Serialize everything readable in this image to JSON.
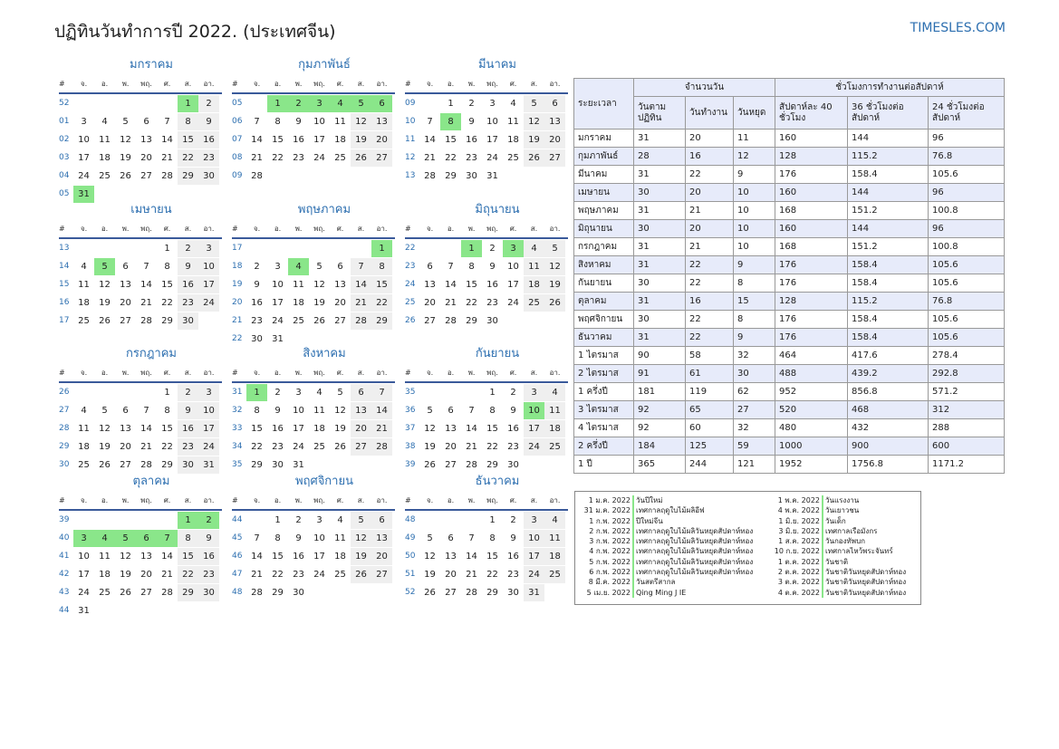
{
  "title": "ปฏิทินวันทำการปี 2022. (ประเทศจีน)",
  "site": "TIMESLES.COM",
  "day_headers": [
    "#",
    "จ.",
    "อ.",
    "พ.",
    "พฤ.",
    "ศ.",
    "ส.",
    "อา."
  ],
  "months": [
    {
      "name": "มกราคม",
      "weeks": [
        {
          "w": "52",
          "days": [
            "",
            "",
            "",
            "",
            "",
            "1",
            "2"
          ],
          "hol": [
            5
          ]
        },
        {
          "w": "01",
          "days": [
            "3",
            "4",
            "5",
            "6",
            "7",
            "8",
            "9"
          ],
          "hol": []
        },
        {
          "w": "02",
          "days": [
            "10",
            "11",
            "12",
            "13",
            "14",
            "15",
            "16"
          ],
          "hol": []
        },
        {
          "w": "03",
          "days": [
            "17",
            "18",
            "19",
            "20",
            "21",
            "22",
            "23"
          ],
          "hol": []
        },
        {
          "w": "04",
          "days": [
            "24",
            "25",
            "26",
            "27",
            "28",
            "29",
            "30"
          ],
          "hol": []
        },
        {
          "w": "05",
          "days": [
            "31",
            "",
            "",
            "",
            "",
            "",
            ""
          ],
          "hol": [
            0
          ]
        }
      ]
    },
    {
      "name": "กุมภาพันธ์",
      "weeks": [
        {
          "w": "05",
          "days": [
            "",
            "1",
            "2",
            "3",
            "4",
            "5",
            "6"
          ],
          "hol": [
            1,
            2,
            3,
            4,
            5,
            6
          ]
        },
        {
          "w": "06",
          "days": [
            "7",
            "8",
            "9",
            "10",
            "11",
            "12",
            "13"
          ],
          "hol": []
        },
        {
          "w": "07",
          "days": [
            "14",
            "15",
            "16",
            "17",
            "18",
            "19",
            "20"
          ],
          "hol": []
        },
        {
          "w": "08",
          "days": [
            "21",
            "22",
            "23",
            "24",
            "25",
            "26",
            "27"
          ],
          "hol": []
        },
        {
          "w": "09",
          "days": [
            "28",
            "",
            "",
            "",
            "",
            "",
            ""
          ],
          "hol": []
        }
      ]
    },
    {
      "name": "มีนาคม",
      "weeks": [
        {
          "w": "09",
          "days": [
            "",
            "1",
            "2",
            "3",
            "4",
            "5",
            "6"
          ],
          "hol": []
        },
        {
          "w": "10",
          "days": [
            "7",
            "8",
            "9",
            "10",
            "11",
            "12",
            "13"
          ],
          "hol": [
            1
          ]
        },
        {
          "w": "11",
          "days": [
            "14",
            "15",
            "16",
            "17",
            "18",
            "19",
            "20"
          ],
          "hol": []
        },
        {
          "w": "12",
          "days": [
            "21",
            "22",
            "23",
            "24",
            "25",
            "26",
            "27"
          ],
          "hol": []
        },
        {
          "w": "13",
          "days": [
            "28",
            "29",
            "30",
            "31",
            "",
            "",
            ""
          ],
          "hol": []
        }
      ]
    },
    {
      "name": "เมษายน",
      "weeks": [
        {
          "w": "13",
          "days": [
            "",
            "",
            "",
            "",
            "1",
            "2",
            "3"
          ],
          "hol": []
        },
        {
          "w": "14",
          "days": [
            "4",
            "5",
            "6",
            "7",
            "8",
            "9",
            "10"
          ],
          "hol": [
            1
          ]
        },
        {
          "w": "15",
          "days": [
            "11",
            "12",
            "13",
            "14",
            "15",
            "16",
            "17"
          ],
          "hol": []
        },
        {
          "w": "16",
          "days": [
            "18",
            "19",
            "20",
            "21",
            "22",
            "23",
            "24"
          ],
          "hol": []
        },
        {
          "w": "17",
          "days": [
            "25",
            "26",
            "27",
            "28",
            "29",
            "30",
            ""
          ],
          "hol": []
        }
      ]
    },
    {
      "name": "พฤษภาคม",
      "weeks": [
        {
          "w": "17",
          "days": [
            "",
            "",
            "",
            "",
            "",
            "",
            "1"
          ],
          "hol": [
            6
          ]
        },
        {
          "w": "18",
          "days": [
            "2",
            "3",
            "4",
            "5",
            "6",
            "7",
            "8"
          ],
          "hol": [
            2
          ]
        },
        {
          "w": "19",
          "days": [
            "9",
            "10",
            "11",
            "12",
            "13",
            "14",
            "15"
          ],
          "hol": []
        },
        {
          "w": "20",
          "days": [
            "16",
            "17",
            "18",
            "19",
            "20",
            "21",
            "22"
          ],
          "hol": []
        },
        {
          "w": "21",
          "days": [
            "23",
            "24",
            "25",
            "26",
            "27",
            "28",
            "29"
          ],
          "hol": []
        },
        {
          "w": "22",
          "days": [
            "30",
            "31",
            "",
            "",
            "",
            "",
            ""
          ],
          "hol": []
        }
      ]
    },
    {
      "name": "มิถุนายน",
      "weeks": [
        {
          "w": "22",
          "days": [
            "",
            "",
            "1",
            "2",
            "3",
            "4",
            "5"
          ],
          "hol": [
            2,
            4
          ]
        },
        {
          "w": "23",
          "days": [
            "6",
            "7",
            "8",
            "9",
            "10",
            "11",
            "12"
          ],
          "hol": []
        },
        {
          "w": "24",
          "days": [
            "13",
            "14",
            "15",
            "16",
            "17",
            "18",
            "19"
          ],
          "hol": []
        },
        {
          "w": "25",
          "days": [
            "20",
            "21",
            "22",
            "23",
            "24",
            "25",
            "26"
          ],
          "hol": []
        },
        {
          "w": "26",
          "days": [
            "27",
            "28",
            "29",
            "30",
            "",
            "",
            ""
          ],
          "hol": []
        }
      ]
    },
    {
      "name": "กรกฎาคม",
      "weeks": [
        {
          "w": "26",
          "days": [
            "",
            "",
            "",
            "",
            "1",
            "2",
            "3"
          ],
          "hol": []
        },
        {
          "w": "27",
          "days": [
            "4",
            "5",
            "6",
            "7",
            "8",
            "9",
            "10"
          ],
          "hol": []
        },
        {
          "w": "28",
          "days": [
            "11",
            "12",
            "13",
            "14",
            "15",
            "16",
            "17"
          ],
          "hol": []
        },
        {
          "w": "29",
          "days": [
            "18",
            "19",
            "20",
            "21",
            "22",
            "23",
            "24"
          ],
          "hol": []
        },
        {
          "w": "30",
          "days": [
            "25",
            "26",
            "27",
            "28",
            "29",
            "30",
            "31"
          ],
          "hol": []
        }
      ]
    },
    {
      "name": "สิงหาคม",
      "weeks": [
        {
          "w": "31",
          "days": [
            "1",
            "2",
            "3",
            "4",
            "5",
            "6",
            "7"
          ],
          "hol": [
            0
          ]
        },
        {
          "w": "32",
          "days": [
            "8",
            "9",
            "10",
            "11",
            "12",
            "13",
            "14"
          ],
          "hol": []
        },
        {
          "w": "33",
          "days": [
            "15",
            "16",
            "17",
            "18",
            "19",
            "20",
            "21"
          ],
          "hol": []
        },
        {
          "w": "34",
          "days": [
            "22",
            "23",
            "24",
            "25",
            "26",
            "27",
            "28"
          ],
          "hol": []
        },
        {
          "w": "35",
          "days": [
            "29",
            "30",
            "31",
            "",
            "",
            "",
            ""
          ],
          "hol": []
        }
      ]
    },
    {
      "name": "กันยายน",
      "weeks": [
        {
          "w": "35",
          "days": [
            "",
            "",
            "",
            "1",
            "2",
            "3",
            "4"
          ],
          "hol": []
        },
        {
          "w": "36",
          "days": [
            "5",
            "6",
            "7",
            "8",
            "9",
            "10",
            "11"
          ],
          "hol": [
            5
          ]
        },
        {
          "w": "37",
          "days": [
            "12",
            "13",
            "14",
            "15",
            "16",
            "17",
            "18"
          ],
          "hol": []
        },
        {
          "w": "38",
          "days": [
            "19",
            "20",
            "21",
            "22",
            "23",
            "24",
            "25"
          ],
          "hol": []
        },
        {
          "w": "39",
          "days": [
            "26",
            "27",
            "28",
            "29",
            "30",
            "",
            ""
          ],
          "hol": []
        }
      ]
    },
    {
      "name": "ตุลาคม",
      "weeks": [
        {
          "w": "39",
          "days": [
            "",
            "",
            "",
            "",
            "",
            "1",
            "2"
          ],
          "hol": [
            5,
            6
          ]
        },
        {
          "w": "40",
          "days": [
            "3",
            "4",
            "5",
            "6",
            "7",
            "8",
            "9"
          ],
          "hol": [
            0,
            1,
            2,
            3,
            4
          ]
        },
        {
          "w": "41",
          "days": [
            "10",
            "11",
            "12",
            "13",
            "14",
            "15",
            "16"
          ],
          "hol": []
        },
        {
          "w": "42",
          "days": [
            "17",
            "18",
            "19",
            "20",
            "21",
            "22",
            "23"
          ],
          "hol": []
        },
        {
          "w": "43",
          "days": [
            "24",
            "25",
            "26",
            "27",
            "28",
            "29",
            "30"
          ],
          "hol": []
        },
        {
          "w": "44",
          "days": [
            "31",
            "",
            "",
            "",
            "",
            "",
            ""
          ],
          "hol": []
        }
      ]
    },
    {
      "name": "พฤศจิกายน",
      "weeks": [
        {
          "w": "44",
          "days": [
            "",
            "1",
            "2",
            "3",
            "4",
            "5",
            "6"
          ],
          "hol": []
        },
        {
          "w": "45",
          "days": [
            "7",
            "8",
            "9",
            "10",
            "11",
            "12",
            "13"
          ],
          "hol": []
        },
        {
          "w": "46",
          "days": [
            "14",
            "15",
            "16",
            "17",
            "18",
            "19",
            "20"
          ],
          "hol": []
        },
        {
          "w": "47",
          "days": [
            "21",
            "22",
            "23",
            "24",
            "25",
            "26",
            "27"
          ],
          "hol": []
        },
        {
          "w": "48",
          "days": [
            "28",
            "29",
            "30",
            "",
            "",
            "",
            ""
          ],
          "hol": []
        }
      ]
    },
    {
      "name": "ธันวาคม",
      "weeks": [
        {
          "w": "48",
          "days": [
            "",
            "",
            "",
            "1",
            "2",
            "3",
            "4"
          ],
          "hol": []
        },
        {
          "w": "49",
          "days": [
            "5",
            "6",
            "7",
            "8",
            "9",
            "10",
            "11"
          ],
          "hol": []
        },
        {
          "w": "50",
          "days": [
            "12",
            "13",
            "14",
            "15",
            "16",
            "17",
            "18"
          ],
          "hol": []
        },
        {
          "w": "51",
          "days": [
            "19",
            "20",
            "21",
            "22",
            "23",
            "24",
            "25"
          ],
          "hol": []
        },
        {
          "w": "52",
          "days": [
            "26",
            "27",
            "28",
            "29",
            "30",
            "31",
            ""
          ],
          "hol": []
        }
      ]
    }
  ],
  "hours_table": {
    "period_label": "ระยะเวลา",
    "days_group": "จำนวนวัน",
    "hours_group": "ชั่วโมงการทำงานต่อสัปดาห์",
    "cols": [
      "วันตามปฏิทิน",
      "วันทำงาน",
      "วันหยุด",
      "สัปดาห์ละ 40 ชั่วโมง",
      "36 ชั่วโมงต่อสัปดาห์",
      "24 ชั่วโมงต่อสัปดาห์"
    ],
    "rows": [
      [
        "มกราคม",
        "31",
        "20",
        "11",
        "160",
        "144",
        "96"
      ],
      [
        "กุมภาพันธ์",
        "28",
        "16",
        "12",
        "128",
        "115.2",
        "76.8"
      ],
      [
        "มีนาคม",
        "31",
        "22",
        "9",
        "176",
        "158.4",
        "105.6"
      ],
      [
        "เมษายน",
        "30",
        "20",
        "10",
        "160",
        "144",
        "96"
      ],
      [
        "พฤษภาคม",
        "31",
        "21",
        "10",
        "168",
        "151.2",
        "100.8"
      ],
      [
        "มิถุนายน",
        "30",
        "20",
        "10",
        "160",
        "144",
        "96"
      ],
      [
        "กรกฎาคม",
        "31",
        "21",
        "10",
        "168",
        "151.2",
        "100.8"
      ],
      [
        "สิงหาคม",
        "31",
        "22",
        "9",
        "176",
        "158.4",
        "105.6"
      ],
      [
        "กันยายน",
        "30",
        "22",
        "8",
        "176",
        "158.4",
        "105.6"
      ],
      [
        "ตุลาคม",
        "31",
        "16",
        "15",
        "128",
        "115.2",
        "76.8"
      ],
      [
        "พฤศจิกายน",
        "30",
        "22",
        "8",
        "176",
        "158.4",
        "105.6"
      ],
      [
        "ธันวาคม",
        "31",
        "22",
        "9",
        "176",
        "158.4",
        "105.6"
      ],
      [
        "1 ไตรมาส",
        "90",
        "58",
        "32",
        "464",
        "417.6",
        "278.4"
      ],
      [
        "2 ไตรมาส",
        "91",
        "61",
        "30",
        "488",
        "439.2",
        "292.8"
      ],
      [
        "1 ครึ่งปี",
        "181",
        "119",
        "62",
        "952",
        "856.8",
        "571.2"
      ],
      [
        "3 ไตรมาส",
        "92",
        "65",
        "27",
        "520",
        "468",
        "312"
      ],
      [
        "4 ไตรมาส",
        "92",
        "60",
        "32",
        "480",
        "432",
        "288"
      ],
      [
        "2 ครึ่งปี",
        "184",
        "125",
        "59",
        "1000",
        "900",
        "600"
      ],
      [
        "1 ปี",
        "365",
        "244",
        "121",
        "1952",
        "1756.8",
        "1171.2"
      ]
    ]
  },
  "holidays_left": [
    {
      "date": "1 ม.ค. 2022",
      "name": "วันปีใหม่"
    },
    {
      "date": "31 ม.ค. 2022",
      "name": "เทศกาลฤดูใบไม้ผลิอีฟ"
    },
    {
      "date": "1 ก.พ. 2022",
      "name": "ปีใหม่จีน"
    },
    {
      "date": "2 ก.พ. 2022",
      "name": "เทศกาลฤดูใบไม้ผลิวันหยุดสัปดาห์ทอง"
    },
    {
      "date": "3 ก.พ. 2022",
      "name": "เทศกาลฤดูใบไม้ผลิวันหยุดสัปดาห์ทอง"
    },
    {
      "date": "4 ก.พ. 2022",
      "name": "เทศกาลฤดูใบไม้ผลิวันหยุดสัปดาห์ทอง"
    },
    {
      "date": "5 ก.พ. 2022",
      "name": "เทศกาลฤดูใบไม้ผลิวันหยุดสัปดาห์ทอง"
    },
    {
      "date": "6 ก.พ. 2022",
      "name": "เทศกาลฤดูใบไม้ผลิวันหยุดสัปดาห์ทอง"
    },
    {
      "date": "8 มี.ค. 2022",
      "name": "วันสตรีสากล"
    },
    {
      "date": "5 เม.ย. 2022",
      "name": "Qing Ming J IE"
    }
  ],
  "holidays_right": [
    {
      "date": "1 พ.ค. 2022",
      "name": "วันแรงงาน"
    },
    {
      "date": "4 พ.ค. 2022",
      "name": "วันเยาวชน"
    },
    {
      "date": "1 มิ.ย. 2022",
      "name": "วันเด็ก"
    },
    {
      "date": "3 มิ.ย. 2022",
      "name": "เทศกาลเรือมังกร"
    },
    {
      "date": "1 ส.ค. 2022",
      "name": "วันกองทัพบก"
    },
    {
      "date": "10 ก.ย. 2022",
      "name": "เทศกาลไหว้พระจันทร์"
    },
    {
      "date": "1 ต.ค. 2022",
      "name": "วันชาติ"
    },
    {
      "date": "2 ต.ค. 2022",
      "name": "วันชาติวันหยุดสัปดาห์ทอง"
    },
    {
      "date": "3 ต.ค. 2022",
      "name": "วันชาติวันหยุดสัปดาห์ทอง"
    },
    {
      "date": "4 ต.ค. 2022",
      "name": "วันชาติวันหยุดสัปดาห์ทอง"
    }
  ],
  "colors": {
    "accent": "#2d6fb0",
    "holiday": "#8ae68a",
    "weekend": "#efefef",
    "header": "#e7ebfa"
  }
}
